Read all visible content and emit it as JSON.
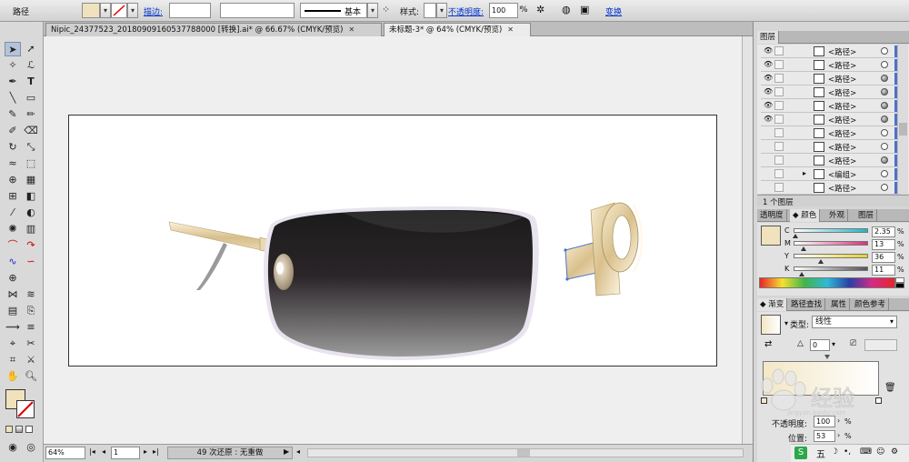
{
  "control_bar": {
    "selection_label": "路径",
    "stroke_label": "描边:",
    "stroke_profile": "基本",
    "style_label": "样式:",
    "opacity_label": "不透明度:",
    "opacity_value": "100",
    "opacity_unit": "%",
    "transform_link": "变换"
  },
  "tabs": [
    {
      "label": "Nipic_24377523_20180909160537788000 [转换].ai* @ 66.67% (CMYK/预览)",
      "active": false
    },
    {
      "label": "未标题-3* @ 64% (CMYK/预览)",
      "active": true
    }
  ],
  "status_bar": {
    "zoom": "64%",
    "page": "1",
    "history_text": "49 次还原 : 无重做"
  },
  "layers_panel": {
    "title": "图层",
    "footer": "1 个图层",
    "rows": [
      {
        "name": "<路径>",
        "target": "empty"
      },
      {
        "name": "<路径>",
        "target": "empty"
      },
      {
        "name": "<路径>",
        "target": "filled"
      },
      {
        "name": "<路径>",
        "target": "filled"
      },
      {
        "name": "<路径>",
        "target": "filled"
      },
      {
        "name": "<路径>",
        "target": "filled"
      },
      {
        "name": "<路径>",
        "target": "empty"
      },
      {
        "name": "<路径>",
        "target": "empty"
      },
      {
        "name": "<路径>",
        "target": "filled"
      },
      {
        "name": "<编组>",
        "target": "empty"
      },
      {
        "name": "<路径>",
        "target": "empty"
      }
    ]
  },
  "color_panel": {
    "tabs": [
      "透明度",
      "颜色",
      "外观",
      "图层"
    ],
    "channels": [
      {
        "label": "C",
        "value": "2.35",
        "level": 0.0235,
        "color": "#1fb5c9"
      },
      {
        "label": "M",
        "value": "13",
        "level": 0.13,
        "color": "#d9327e"
      },
      {
        "label": "Y",
        "value": "36",
        "level": 0.36,
        "color": "#e6d22b"
      },
      {
        "label": "K",
        "value": "11",
        "level": 0.11,
        "color": "#555555"
      }
    ],
    "unit": "%"
  },
  "gradient_panel": {
    "tabs": [
      "渐变",
      "路径查找",
      "属性",
      "颜色参考"
    ],
    "type_label": "类型:",
    "type_value": "线性",
    "angle_value": "0",
    "opacity_label": "不透明度:",
    "opacity_value": "100",
    "opacity_unit": "%",
    "location_label": "位置:",
    "location_value": "53",
    "location_unit": "%",
    "start_color": "#f3e7c6",
    "end_color": "#ffffff"
  },
  "colors": {
    "fill": "#f0e2bc",
    "accent_blue": "#4a73c9",
    "artboard": "#ffffff"
  },
  "watermark": {
    "text": "经验",
    "sub": "jingyan.baidu.com"
  }
}
